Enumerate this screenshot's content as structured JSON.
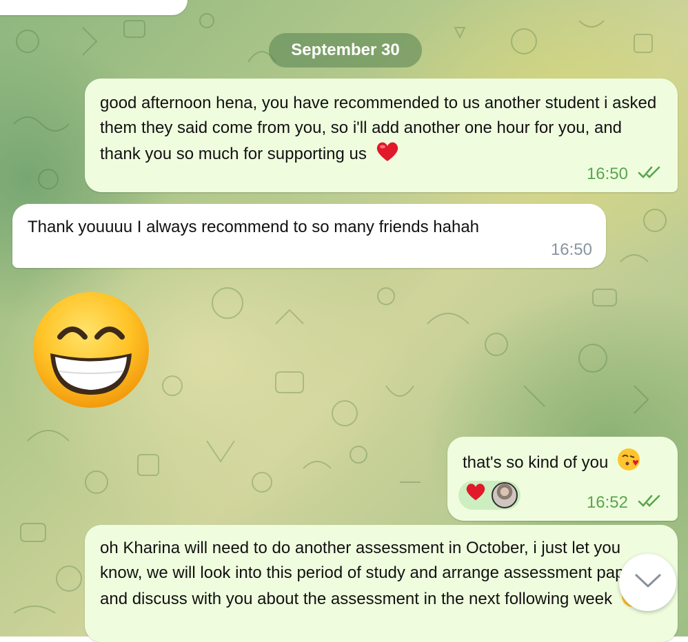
{
  "date_separator": "September 30",
  "messages": [
    {
      "direction": "outgoing",
      "text": "good afternoon hena, you have recommended to us another student i asked them they said come from you, so i'll add another one hour for you, and thank you so much for supporting us",
      "emoji": "red-heart",
      "time": "16:50",
      "status": "read"
    },
    {
      "direction": "incoming",
      "text": "Thank youuuu I always recommend to so many friends hahah",
      "time": "16:50"
    },
    {
      "direction": "incoming",
      "type": "sticker",
      "emoji": "grinning-face-with-smiling-eyes"
    },
    {
      "direction": "outgoing",
      "text": "that's so kind of you",
      "emoji": "face-blowing-a-kiss",
      "reactions": [
        "red-heart",
        "user-avatar"
      ],
      "time": "16:52",
      "status": "read"
    },
    {
      "direction": "outgoing",
      "text": "oh Kharina will need to do another assessment in October, i just let you know, we will look into this period of study and arrange assessment paper and discuss with you about the assessment",
      "text_end": "in the next following week",
      "emoji": "smiling-face-with-smiling-eyes"
    }
  ],
  "colors": {
    "outgoing_bubble": "#effdde",
    "incoming_bubble": "#ffffff",
    "outgoing_time": "#58a64d",
    "incoming_time": "#8a949e",
    "date_pill": "#5a8252"
  }
}
